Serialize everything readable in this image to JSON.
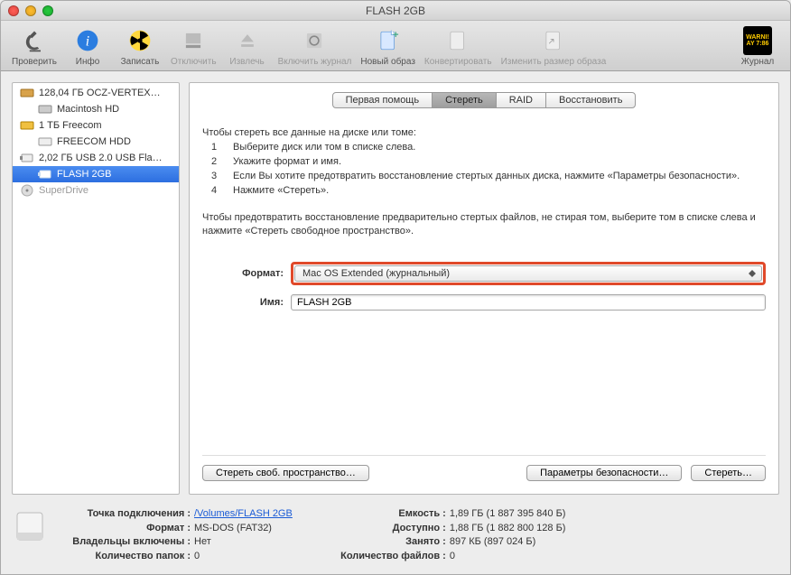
{
  "window": {
    "title": "FLASH 2GB"
  },
  "toolbar": {
    "verify": "Проверить",
    "info": "Инфо",
    "burn": "Записать",
    "unmount": "Отключить",
    "eject": "Извлечь",
    "enable_journal": "Включить журнал",
    "new_image": "Новый образ",
    "convert": "Конвертировать",
    "resize_image": "Изменить размер образа",
    "log": "Журнал",
    "warn_line1": "WARNI!",
    "warn_line2": "AY 7:86"
  },
  "sidebar": {
    "items": [
      {
        "label": "128,04 ГБ OCZ-VERTEX…"
      },
      {
        "label": "Macintosh HD"
      },
      {
        "label": "1 ТБ Freecom"
      },
      {
        "label": "FREECOM HDD"
      },
      {
        "label": "2,02 ГБ USB 2.0 USB Fla…"
      },
      {
        "label": "FLASH 2GB"
      },
      {
        "label": "SuperDrive"
      }
    ]
  },
  "tabs": {
    "first_aid": "Первая помощь",
    "erase": "Стереть",
    "raid": "RAID",
    "restore": "Восстановить"
  },
  "instructions": {
    "intro": "Чтобы стереть все данные на диске или томе:",
    "s1": "Выберите диск или том в списке слева.",
    "s2": "Укажите формат и имя.",
    "s3": "Если Вы хотите предотвратить восстановление стертых данных диска, нажмите «Параметры безопасности».",
    "s4": "Нажмите «Стереть».",
    "note": "Чтобы предотвратить восстановление предварительно стертых файлов, не стирая том, выберите том в списке слева и нажмите «Стереть свободное пространство»."
  },
  "form": {
    "format_label": "Формат:",
    "format_value": "Mac OS Extended (журнальный)",
    "name_label": "Имя:",
    "name_value": "FLASH 2GB"
  },
  "buttons": {
    "erase_free": "Стереть своб. пространство…",
    "security": "Параметры безопасности…",
    "erase": "Стереть…"
  },
  "footer": {
    "mount_k": "Точка подключения :",
    "mount_v": "/Volumes/FLASH 2GB",
    "format_k": "Формат :",
    "format_v": "MS-DOS (FAT32)",
    "owners_k": "Владельцы включены :",
    "owners_v": "Нет",
    "folders_k": "Количество папок :",
    "folders_v": "0",
    "capacity_k": "Емкость :",
    "capacity_v": "1,89 ГБ (1 887 395 840 Б)",
    "available_k": "Доступно :",
    "available_v": "1,88 ГБ (1 882 800 128 Б)",
    "used_k": "Занято :",
    "used_v": "897 КБ (897 024 Б)",
    "files_k": "Количество файлов :",
    "files_v": "0"
  }
}
